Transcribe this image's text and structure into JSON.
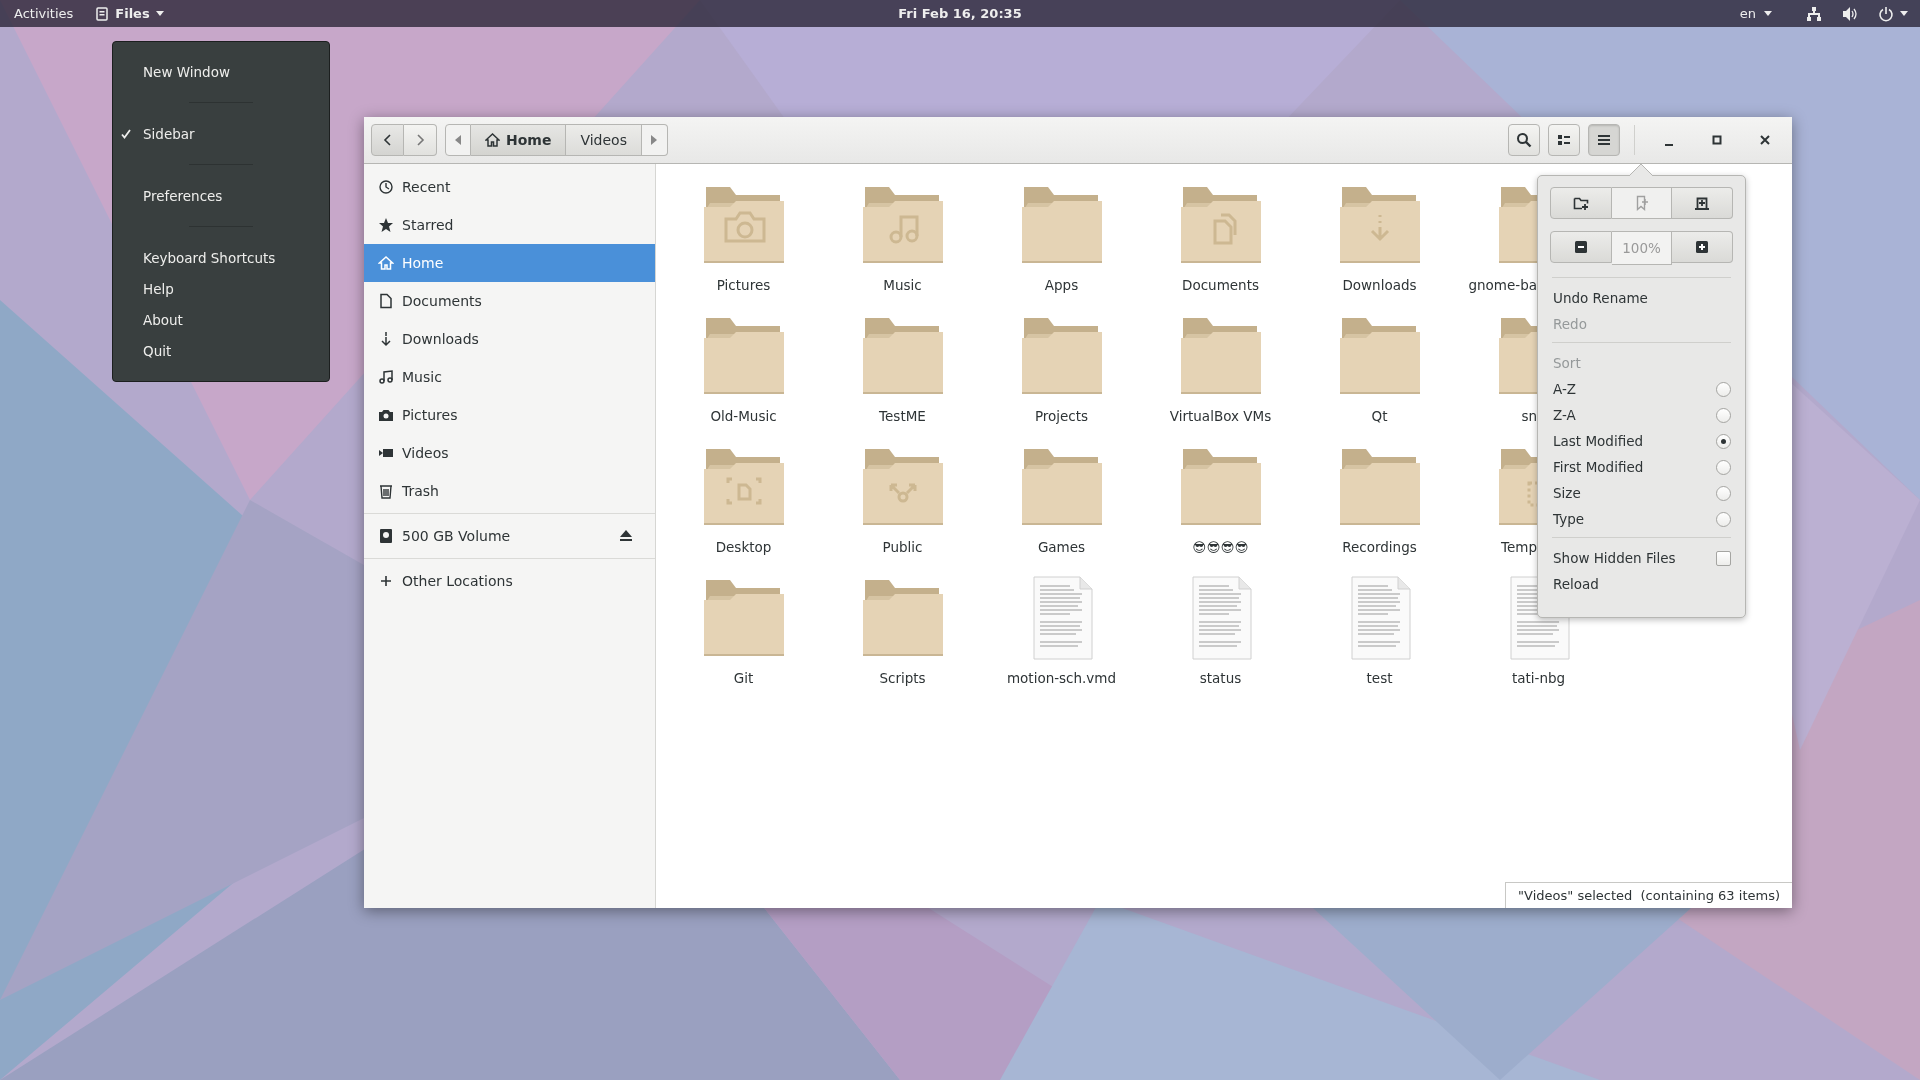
{
  "top_bar": {
    "activities": "Activities",
    "app_name": "Files",
    "clock": "Fri Feb 16, 20:35",
    "language": "en"
  },
  "app_menu": {
    "sections": [
      [
        {
          "label": "New Window",
          "checked": false
        }
      ],
      [
        {
          "label": "Sidebar",
          "checked": true
        }
      ],
      [
        {
          "label": "Preferences",
          "checked": false
        }
      ],
      [
        {
          "label": "Keyboard Shortcuts",
          "checked": false
        },
        {
          "label": "Help",
          "checked": false
        },
        {
          "label": "About",
          "checked": false
        },
        {
          "label": "Quit",
          "checked": false
        }
      ]
    ]
  },
  "window": {
    "path_bar": [
      {
        "label": "Home",
        "selected": true
      },
      {
        "label": "Videos",
        "selected": false
      }
    ],
    "header_buttons": [
      {
        "selected": false
      },
      {
        "selected": false
      },
      {
        "selected": true
      }
    ],
    "sidebar": {
      "places": [
        {
          "label": "Recent",
          "selected": false
        },
        {
          "label": "Starred",
          "selected": false
        },
        {
          "label": "Home",
          "selected": true
        },
        {
          "label": "Documents",
          "selected": false
        },
        {
          "label": "Downloads",
          "selected": false
        },
        {
          "label": "Music",
          "selected": false
        },
        {
          "label": "Pictures",
          "selected": false
        },
        {
          "label": "Videos",
          "selected": false
        },
        {
          "label": "Trash",
          "selected": false
        }
      ],
      "devices": [
        {
          "label": "500 GB Volume",
          "selected": false
        }
      ],
      "other": {
        "label": "Other Locations"
      }
    },
    "files": [
      {
        "name": "Pictures",
        "kind": "folder"
      },
      {
        "name": "Music",
        "kind": "folder"
      },
      {
        "name": "Apps",
        "kind": "folder"
      },
      {
        "name": "Documents",
        "kind": "folder"
      },
      {
        "name": "Downloads",
        "kind": "folder"
      },
      {
        "name": "gnome-ba",
        "kind": "folder"
      },
      {
        "name": "Old-Music",
        "kind": "folder"
      },
      {
        "name": "TestME",
        "kind": "folder"
      },
      {
        "name": "Projects",
        "kind": "folder"
      },
      {
        "name": "VirtualBox VMs",
        "kind": "folder"
      },
      {
        "name": "Qt",
        "kind": "folder"
      },
      {
        "name": "sn",
        "kind": "folder"
      },
      {
        "name": "Desktop",
        "kind": "folder"
      },
      {
        "name": "Public",
        "kind": "folder"
      },
      {
        "name": "Games",
        "kind": "folder"
      },
      {
        "name": "😎😎😎😎",
        "kind": "folder"
      },
      {
        "name": "Recordings",
        "kind": "folder"
      },
      {
        "name": "Temp",
        "kind": "folder"
      },
      {
        "name": "Git",
        "kind": "folder"
      },
      {
        "name": "Scripts",
        "kind": "folder"
      },
      {
        "name": "motion-sch.vmd",
        "kind": "file"
      },
      {
        "name": "status",
        "kind": "file"
      },
      {
        "name": "test",
        "kind": "file"
      },
      {
        "name": "tati-nbg",
        "kind": "file"
      }
    ],
    "status": "\"Videos\" selected  (containing 63 items)",
    "popover": {
      "action_buttons": [
        {
          "disabled": false
        },
        {
          "disabled": true
        },
        {
          "disabled": false
        }
      ],
      "zoom": "100%",
      "history": [
        {
          "label": "Undo Rename",
          "disabled": false
        },
        {
          "label": "Redo",
          "disabled": true
        }
      ],
      "sort_title": "Sort",
      "sort": [
        {
          "label": "A-Z",
          "selected": false
        },
        {
          "label": "Z-A",
          "selected": false
        },
        {
          "label": "Last Modified",
          "selected": true
        },
        {
          "label": "First Modified",
          "selected": false
        },
        {
          "label": "Size",
          "selected": false
        },
        {
          "label": "Type",
          "selected": false
        }
      ],
      "options": [
        {
          "label": "Show Hidden Files",
          "kind": "checkbox",
          "checked": false
        },
        {
          "label": "Reload",
          "kind": "action"
        }
      ]
    }
  }
}
